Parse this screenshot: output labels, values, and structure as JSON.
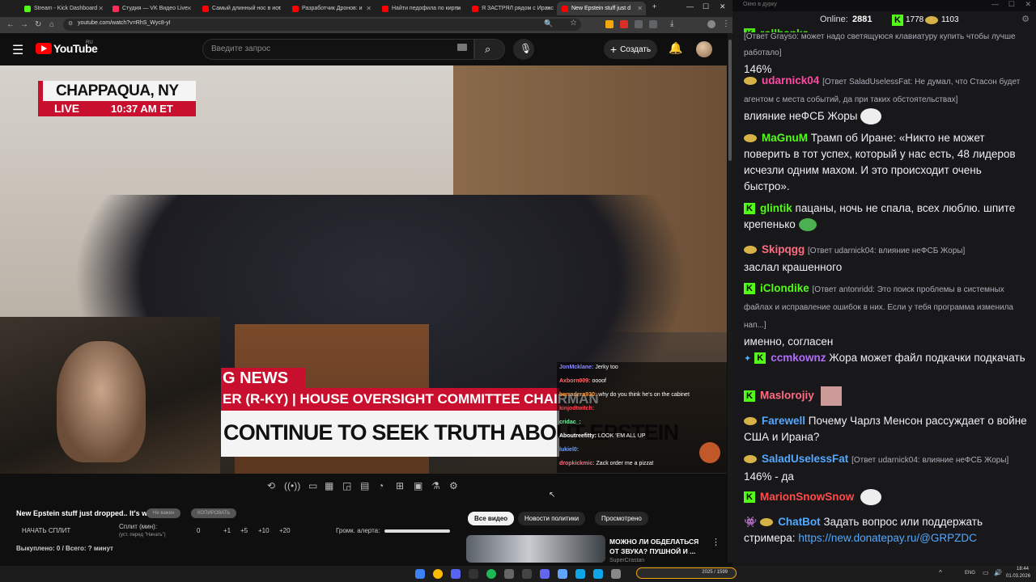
{
  "browser": {
    "tabs": [
      {
        "label": "Stream - Kick Dashboard",
        "color": "#53fc18"
      },
      {
        "label": "Студия — VK Видео Live",
        "color": "#ff2d55"
      },
      {
        "label": "Самый длинный нос в ист",
        "color": "#ff0000"
      },
      {
        "label": "Разработчик Дронов: и",
        "color": "#ff0000"
      },
      {
        "label": "Найти педофила по кирпи",
        "color": "#ff0000"
      },
      {
        "label": "Я ЗАСТРЯЛ рядом с Иранс",
        "color": "#ff0000"
      },
      {
        "label": "New Epstein stuff just d",
        "color": "#ff0000"
      }
    ],
    "url": "youtube.com/watch?v=RhS_Wyc8-yI"
  },
  "youtube": {
    "logo": "YouTube",
    "region": "RU",
    "search_placeholder": "Введите запрос",
    "create_label": "Создать"
  },
  "video": {
    "location": "CHAPPAQUA, NY",
    "live": "LIVE",
    "time": "10:37 AM ET",
    "chyron_brand": "G NEWS",
    "chyron_line1": "ER (R-KY) | HOUSE OVERSIGHT COMMITTEE CHAIRMAN",
    "chyron_line2": "CONTINUE TO SEEK TRUTH ABOUT EPSTEIN",
    "overlay_chat": [
      {
        "user": "JonMcklane:",
        "text": "Jerky too",
        "color": "#8b8bff"
      },
      {
        "user": "Axborn009:",
        "text": "oooof",
        "color": "#ff6b6b"
      },
      {
        "user": "berradera930:",
        "text": "why do you think he's on the cabinet",
        "color": "#ff9f43"
      },
      {
        "user": "kinjodtwitch:",
        "text": "",
        "color": "#ff4757"
      },
      {
        "user": "cridac_:",
        "text": "",
        "color": "#7bed9f"
      },
      {
        "user": "Aboutreefitty:",
        "text": "LOOK 'EM ALL UP",
        "color": "#ffffff"
      },
      {
        "user": "lukiel0:",
        "text": "",
        "color": "#70a1ff"
      },
      {
        "user": "dropkickmic:",
        "text": "Zack order me a pizza!",
        "color": "#ff6b81"
      }
    ]
  },
  "below": {
    "title": "New Epstein stuff just dropped.. It's wild",
    "btn_hide": "Не важен",
    "btn_copy": "КОПИРОВАТЬ",
    "start_split": "НАЧАТЬ СПЛИТ",
    "split_label": "Сплит (мин):",
    "split_hint": "(уст. перед \"Начать\")",
    "split_values": [
      "0",
      "+1",
      "+5",
      "+10",
      "+20"
    ],
    "alert_volume": "Громк. алерта:",
    "bought": "Выкуплено: 0 / Всего: ? минут"
  },
  "filters": [
    "Все видео",
    "Новости политики",
    "Просмотрено"
  ],
  "reco": {
    "title": "МОЖНО ЛИ ОБДЕЛАТЬСЯ ОТ ЗВУКА? ПУШНОЙ И ...",
    "channel": "SuperCrastan"
  },
  "chat": {
    "window_title": "Окно в дурку",
    "online_label": "Online:",
    "online": "2881",
    "kick_count": "1778",
    "other_count": "1103",
    "messages": [
      {
        "badge": "kick",
        "name": "rollbanks",
        "name_color": "#53fc18",
        "reply": "[Ответ Grayso: может надо светящуюся клавиатуру купить чтобы лучше работало]",
        "text": "146%"
      },
      {
        "badge": "nut",
        "name": "udarnick04",
        "name_color": "#ff4aa5",
        "reply": "[Ответ SaladUselessFat: Не думал, что Стасон будет агентом с места событий, да при таких обстоятельствах]",
        "text": "влияние неФСБ Жоры"
      },
      {
        "badge": "nut",
        "name": "MaGnuM",
        "name_color": "#53fc18",
        "reply": "",
        "text": "Трамп об Иране: «Никто не может поверить в тот успех, который у нас есть, 48 лидеров исчезли одним махом. И это происходит очень быстро»."
      },
      {
        "badge": "kick",
        "name": "glintik",
        "name_color": "#53fc18",
        "reply": "",
        "text": "пацаны, ночь не спала, всех люблю. шпите крепенько"
      },
      {
        "badge": "nut",
        "name": "Skipqgg",
        "name_color": "#ff6b81",
        "reply": "[Ответ udarnick04: влияние неФСБ Жоры]",
        "text": "заслал крашенного"
      },
      {
        "badge": "kick",
        "name": "iClondike",
        "name_color": "#53fc18",
        "reply": "[Ответ antonridd: Это поиск проблемы в системных файлах и исправление ошибок в них. Если у тебя программа изменила нап...]",
        "text": "именно, согласен"
      },
      {
        "badge": "kick",
        "name": "ccmkownz",
        "name_color": "#b36bff",
        "reply": "",
        "text": "Жора может файл подкачки подкачать"
      },
      {
        "badge": "kick",
        "name": "Maslorojiy",
        "name_color": "#ff6b81",
        "reply": "",
        "text": ""
      },
      {
        "badge": "nut",
        "name": "Farewell",
        "name_color": "#53a8ff",
        "reply": "",
        "text": "Почему Чарлз Менсон рассуждает о войне США и Ирана?"
      },
      {
        "badge": "nut",
        "name": "SaladUselessFat",
        "name_color": "#53a8ff",
        "reply": "[Ответ udarnick04: влияние неФСБ Жоры]",
        "text": "146% - да"
      },
      {
        "badge": "kick",
        "name": "MarionSnowSnow",
        "name_color": "#ff4a4a",
        "reply": "",
        "text": ""
      },
      {
        "badge": "nut",
        "name": "ChatBot",
        "name_color": "#53a8ff",
        "reply": "",
        "text": "Задать вопрос или поддержать стримера:",
        "link": "https://new.donatepay.ru/@GRPZDC"
      }
    ]
  },
  "taskbar": {
    "lang": "ENG",
    "time": "18:44",
    "date": "01.03.2026",
    "media": "2025 / 1599"
  }
}
